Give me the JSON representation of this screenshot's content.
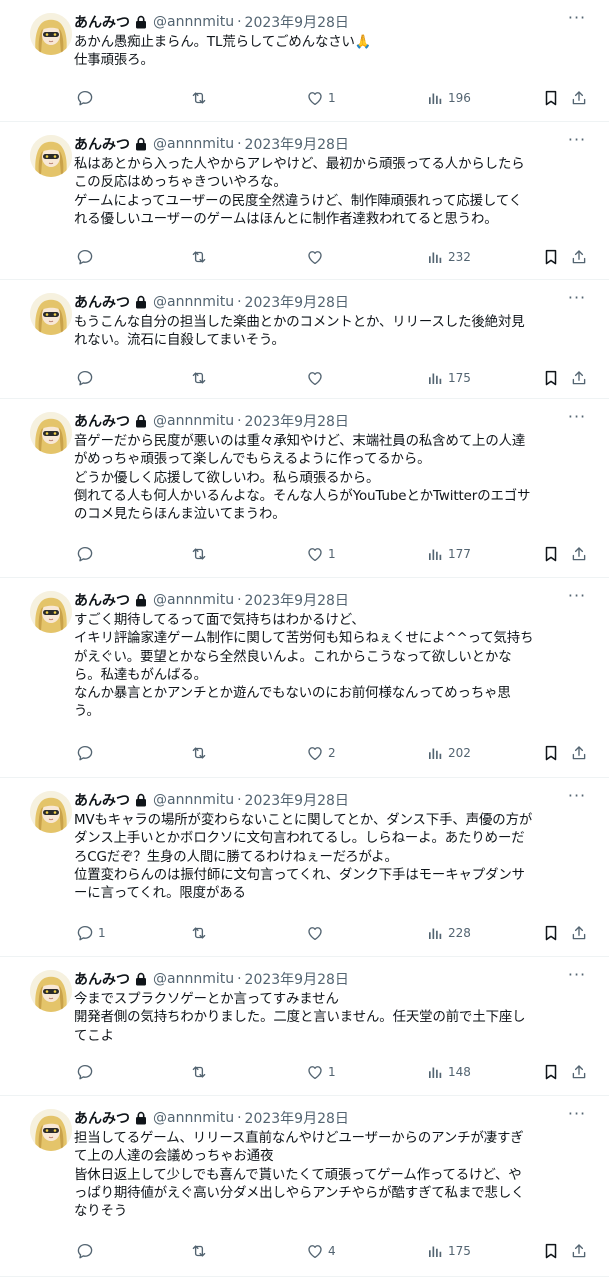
{
  "tweets": [
    {
      "name": "あんみつ",
      "handle": "@annnmitu",
      "date": "2023年9月28日",
      "lines": [
        "あかん愚痴止まらん。TL荒らしてごめんなさい🙏",
        "仕事頑張ろ。"
      ],
      "replies": "",
      "retweets": "",
      "likes": "1",
      "views": "196"
    },
    {
      "name": "あんみつ",
      "handle": "@annnmitu",
      "date": "2023年9月28日",
      "lines": [
        "私はあとから入った人やからアレやけど、最初から頑張ってる人からしたら",
        "この反応はめっちゃきついやろな。",
        "ゲームによってユーザーの民度全然違うけど、制作陣頑張れって応援してく",
        "れる優しいユーザーのゲームはほんとに制作者達救われてると思うわ。"
      ],
      "replies": "",
      "retweets": "",
      "likes": "",
      "views": "232"
    },
    {
      "name": "あんみつ",
      "handle": "@annnmitu",
      "date": "2023年9月28日",
      "lines": [
        "もうこんな自分の担当した楽曲とかのコメントとか、リリースした後絶対見",
        "れない。流石に自殺してまいそう。"
      ],
      "replies": "",
      "retweets": "",
      "likes": "",
      "views": "175"
    },
    {
      "name": "あんみつ",
      "handle": "@annnmitu",
      "date": "2023年9月28日",
      "lines": [
        "音ゲーだから民度が悪いのは重々承知やけど、末端社員の私含めて上の人達",
        "がめっちゃ頑張って楽しんでもらえるように作ってるから。",
        "どうか優しく応援して欲しいわ。私ら頑張るから。",
        "倒れてる人も何人かいるんよな。そんな人らがYouTubeとかTwitterのエゴサ",
        "のコメ見たらほんま泣いてまうわ。"
      ],
      "replies": "",
      "retweets": "",
      "likes": "1",
      "views": "177"
    },
    {
      "name": "あんみつ",
      "handle": "@annnmitu",
      "date": "2023年9月28日",
      "lines": [
        "すごく期待してるって面で気持ちはわかるけど、",
        "イキリ評論家達ゲーム制作に関して苦労何も知らねぇくせによ^^って気持ち",
        "がえぐい。要望とかなら全然良いんよ。これからこうなって欲しいとかな",
        "ら。私達もがんばる。",
        "なんか暴言とかアンチとか遊んでもないのにお前何様なんってめっちゃ思",
        "う。"
      ],
      "replies": "",
      "retweets": "",
      "likes": "2",
      "views": "202"
    },
    {
      "name": "あんみつ",
      "handle": "@annnmitu",
      "date": "2023年9月28日",
      "lines": [
        "MVもキャラの場所が変わらないことに関してとか、ダンス下手、声優の方が",
        "ダンス上手いとかボロクソに文句言われてるし。しらねーよ。あたりめーだ",
        "ろCGだぞ？生身の人間に勝てるわけねぇーだろがよ。",
        "位置変わらんのは振付師に文句言ってくれ、ダンク下手はモーキャプダンサ",
        "ーに言ってくれ。限度がある"
      ],
      "replies": "1",
      "retweets": "",
      "likes": "",
      "views": "228"
    },
    {
      "name": "あんみつ",
      "handle": "@annnmitu",
      "date": "2023年9月28日",
      "lines": [
        "今までスプラクソゲーとか言ってすみません",
        "開発者側の気持ちわかりました。二度と言いません。任天堂の前で土下座し",
        "てこよ"
      ],
      "replies": "",
      "retweets": "",
      "likes": "1",
      "views": "148"
    },
    {
      "name": "あんみつ",
      "handle": "@annnmitu",
      "date": "2023年9月28日",
      "lines": [
        "担当してるゲーム、リリース直前なんやけどユーザーからのアンチが凄すぎ",
        "て上の人達の会議めっちゃお通夜",
        "皆休日返上して少しでも喜んで貰いたくて頑張ってゲーム作ってるけど、や",
        "っぱり期待値がえぐ高い分ダメ出しやらアンチやらが酷すぎて私まで悲しく",
        "なりそう"
      ],
      "replies": "",
      "retweets": "",
      "likes": "4",
      "views": "175"
    }
  ]
}
